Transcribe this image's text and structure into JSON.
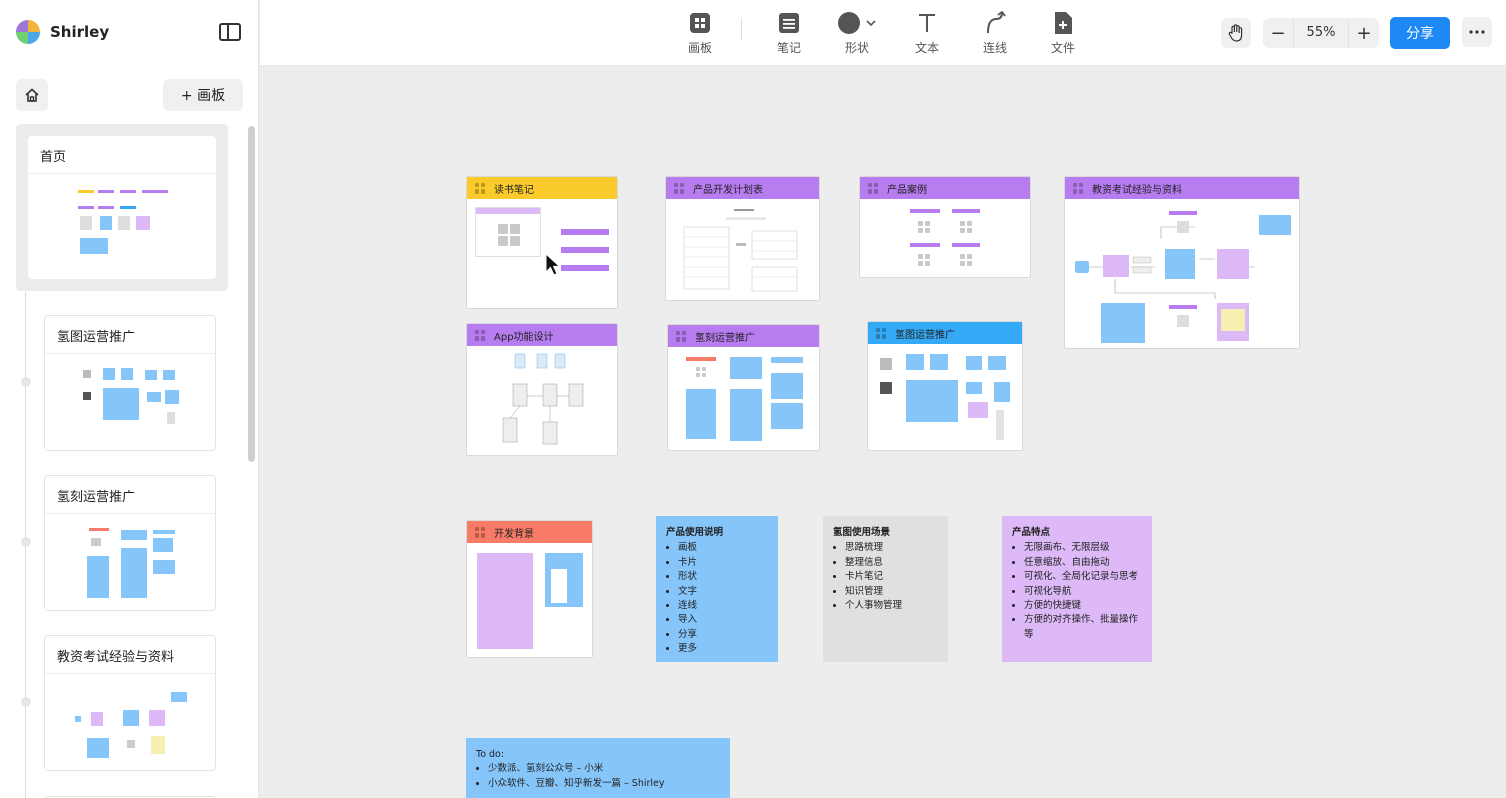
{
  "sidebar": {
    "user_name": "Shirley",
    "add_board_label": "+ 画板",
    "boards": [
      {
        "title": "首页"
      },
      {
        "title": "氢图运营推广"
      },
      {
        "title": "氢刻运营推广"
      },
      {
        "title": "教资考试经验与资料"
      }
    ]
  },
  "toolbar": {
    "tools": [
      {
        "label": "画板",
        "icon": "board-icon"
      },
      {
        "label": "笔记",
        "icon": "note-icon"
      },
      {
        "label": "形状",
        "icon": "shape-icon"
      },
      {
        "label": "文本",
        "icon": "text-icon"
      },
      {
        "label": "连线",
        "icon": "connector-icon"
      },
      {
        "label": "文件",
        "icon": "file-icon"
      }
    ],
    "zoom": "55%",
    "share_label": "分享"
  },
  "canvas": {
    "boards": [
      {
        "title": "读书笔记",
        "color": "#fbcb2c"
      },
      {
        "title": "产品开发计划表",
        "color": "#b77cf0"
      },
      {
        "title": "产品案例",
        "color": "#b77cf0"
      },
      {
        "title": "教资考试经验与资料",
        "color": "#b77cf0"
      },
      {
        "title": "App功能设计",
        "color": "#b77cf0"
      },
      {
        "title": "氢刻运营推广",
        "color": "#b77cf0"
      },
      {
        "title": "氢图运营推广",
        "color": "#34a9f5"
      },
      {
        "title": "开发背景",
        "color": "#f87b67"
      }
    ],
    "notes": {
      "usage": {
        "title": "产品使用说明",
        "items": [
          "画板",
          "卡片",
          "形状",
          "文字",
          "连线",
          "导入",
          "分享",
          "更多"
        ],
        "color": "#86c5fa"
      },
      "scenes": {
        "title": "氢图使用场景",
        "items": [
          "思路梳理",
          "整理信息",
          "卡片笔记",
          "知识管理",
          "个人事物管理"
        ],
        "color": "#e0e0e0"
      },
      "features": {
        "title": "产品特点",
        "items": [
          "无限画布、无限层级",
          "任意缩放、自由拖动",
          "可视化、全局化记录与思考",
          "可视化导航",
          "方便的快捷键",
          "方便的对齐操作、批量操作等"
        ],
        "color": "#ddb9f7"
      },
      "todo": {
        "title": "To do:",
        "items": [
          "少数派、氢刻公众号 – 小米",
          "小众软件、豆瓣、知乎新发一篇 – Shirley"
        ],
        "color": "#86c5fa"
      }
    }
  }
}
